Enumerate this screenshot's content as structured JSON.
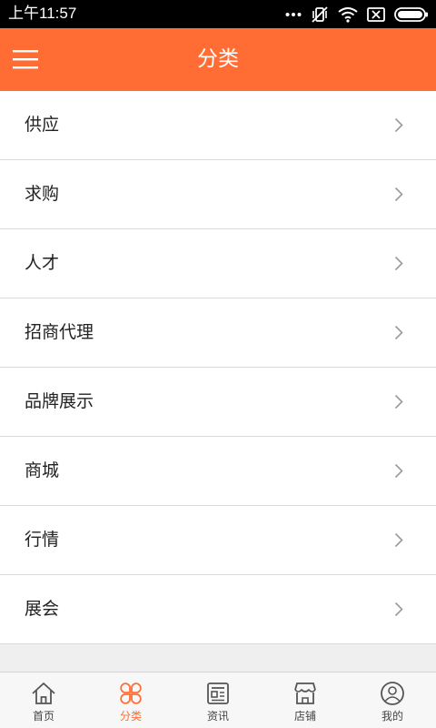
{
  "status_bar": {
    "time": "上午11:57"
  },
  "header": {
    "title": "分类"
  },
  "categories": [
    {
      "label": "供应"
    },
    {
      "label": "求购"
    },
    {
      "label": "人才"
    },
    {
      "label": "招商代理"
    },
    {
      "label": "品牌展示"
    },
    {
      "label": "商城"
    },
    {
      "label": "行情"
    },
    {
      "label": "展会"
    }
  ],
  "bottom_nav": {
    "items": [
      {
        "label": "首页",
        "icon": "home-icon"
      },
      {
        "label": "分类",
        "icon": "category-icon",
        "active": true
      },
      {
        "label": "资讯",
        "icon": "news-icon"
      },
      {
        "label": "店铺",
        "icon": "shop-icon"
      },
      {
        "label": "我的",
        "icon": "user-icon"
      }
    ]
  },
  "colors": {
    "accent": "#ff6d34",
    "nav_inactive": "#555555"
  }
}
